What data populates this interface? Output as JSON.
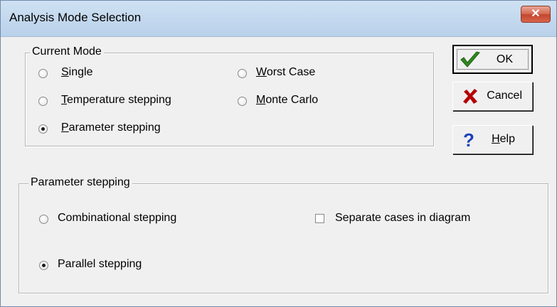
{
  "window": {
    "title": "Analysis Mode Selection",
    "close_glyph": "✕"
  },
  "current_mode": {
    "legend": "Current Mode",
    "options": [
      {
        "label": "Single",
        "accel": "S",
        "rest": "ingle",
        "selected": false
      },
      {
        "label": "Temperature stepping",
        "accel": "T",
        "rest": "emperature stepping",
        "selected": false
      },
      {
        "label": "Parameter stepping",
        "accel": "P",
        "rest": "arameter stepping",
        "selected": true
      },
      {
        "label": "Worst Case",
        "accel": "W",
        "rest": "orst Case",
        "selected": false
      },
      {
        "label": "Monte Carlo",
        "accel": "M",
        "rest": "onte Carlo",
        "selected": false
      }
    ]
  },
  "parameter_stepping": {
    "legend": "Parameter stepping",
    "combinational": {
      "label": "Combinational stepping",
      "selected": false
    },
    "parallel": {
      "label": "Parallel stepping",
      "selected": true
    },
    "separate_cases": {
      "label": "Separate cases in diagram",
      "checked": false
    }
  },
  "buttons": {
    "ok": {
      "label": "OK",
      "icon": "checkmark-icon",
      "icon_color": "#2e8b1e"
    },
    "cancel": {
      "label": "Cancel",
      "icon": "x-icon",
      "icon_color": "#b40000"
    },
    "help": {
      "accel": "H",
      "rest": "elp",
      "label": "Help",
      "icon": "question-icon",
      "icon_color": "#1c3fb8"
    }
  }
}
